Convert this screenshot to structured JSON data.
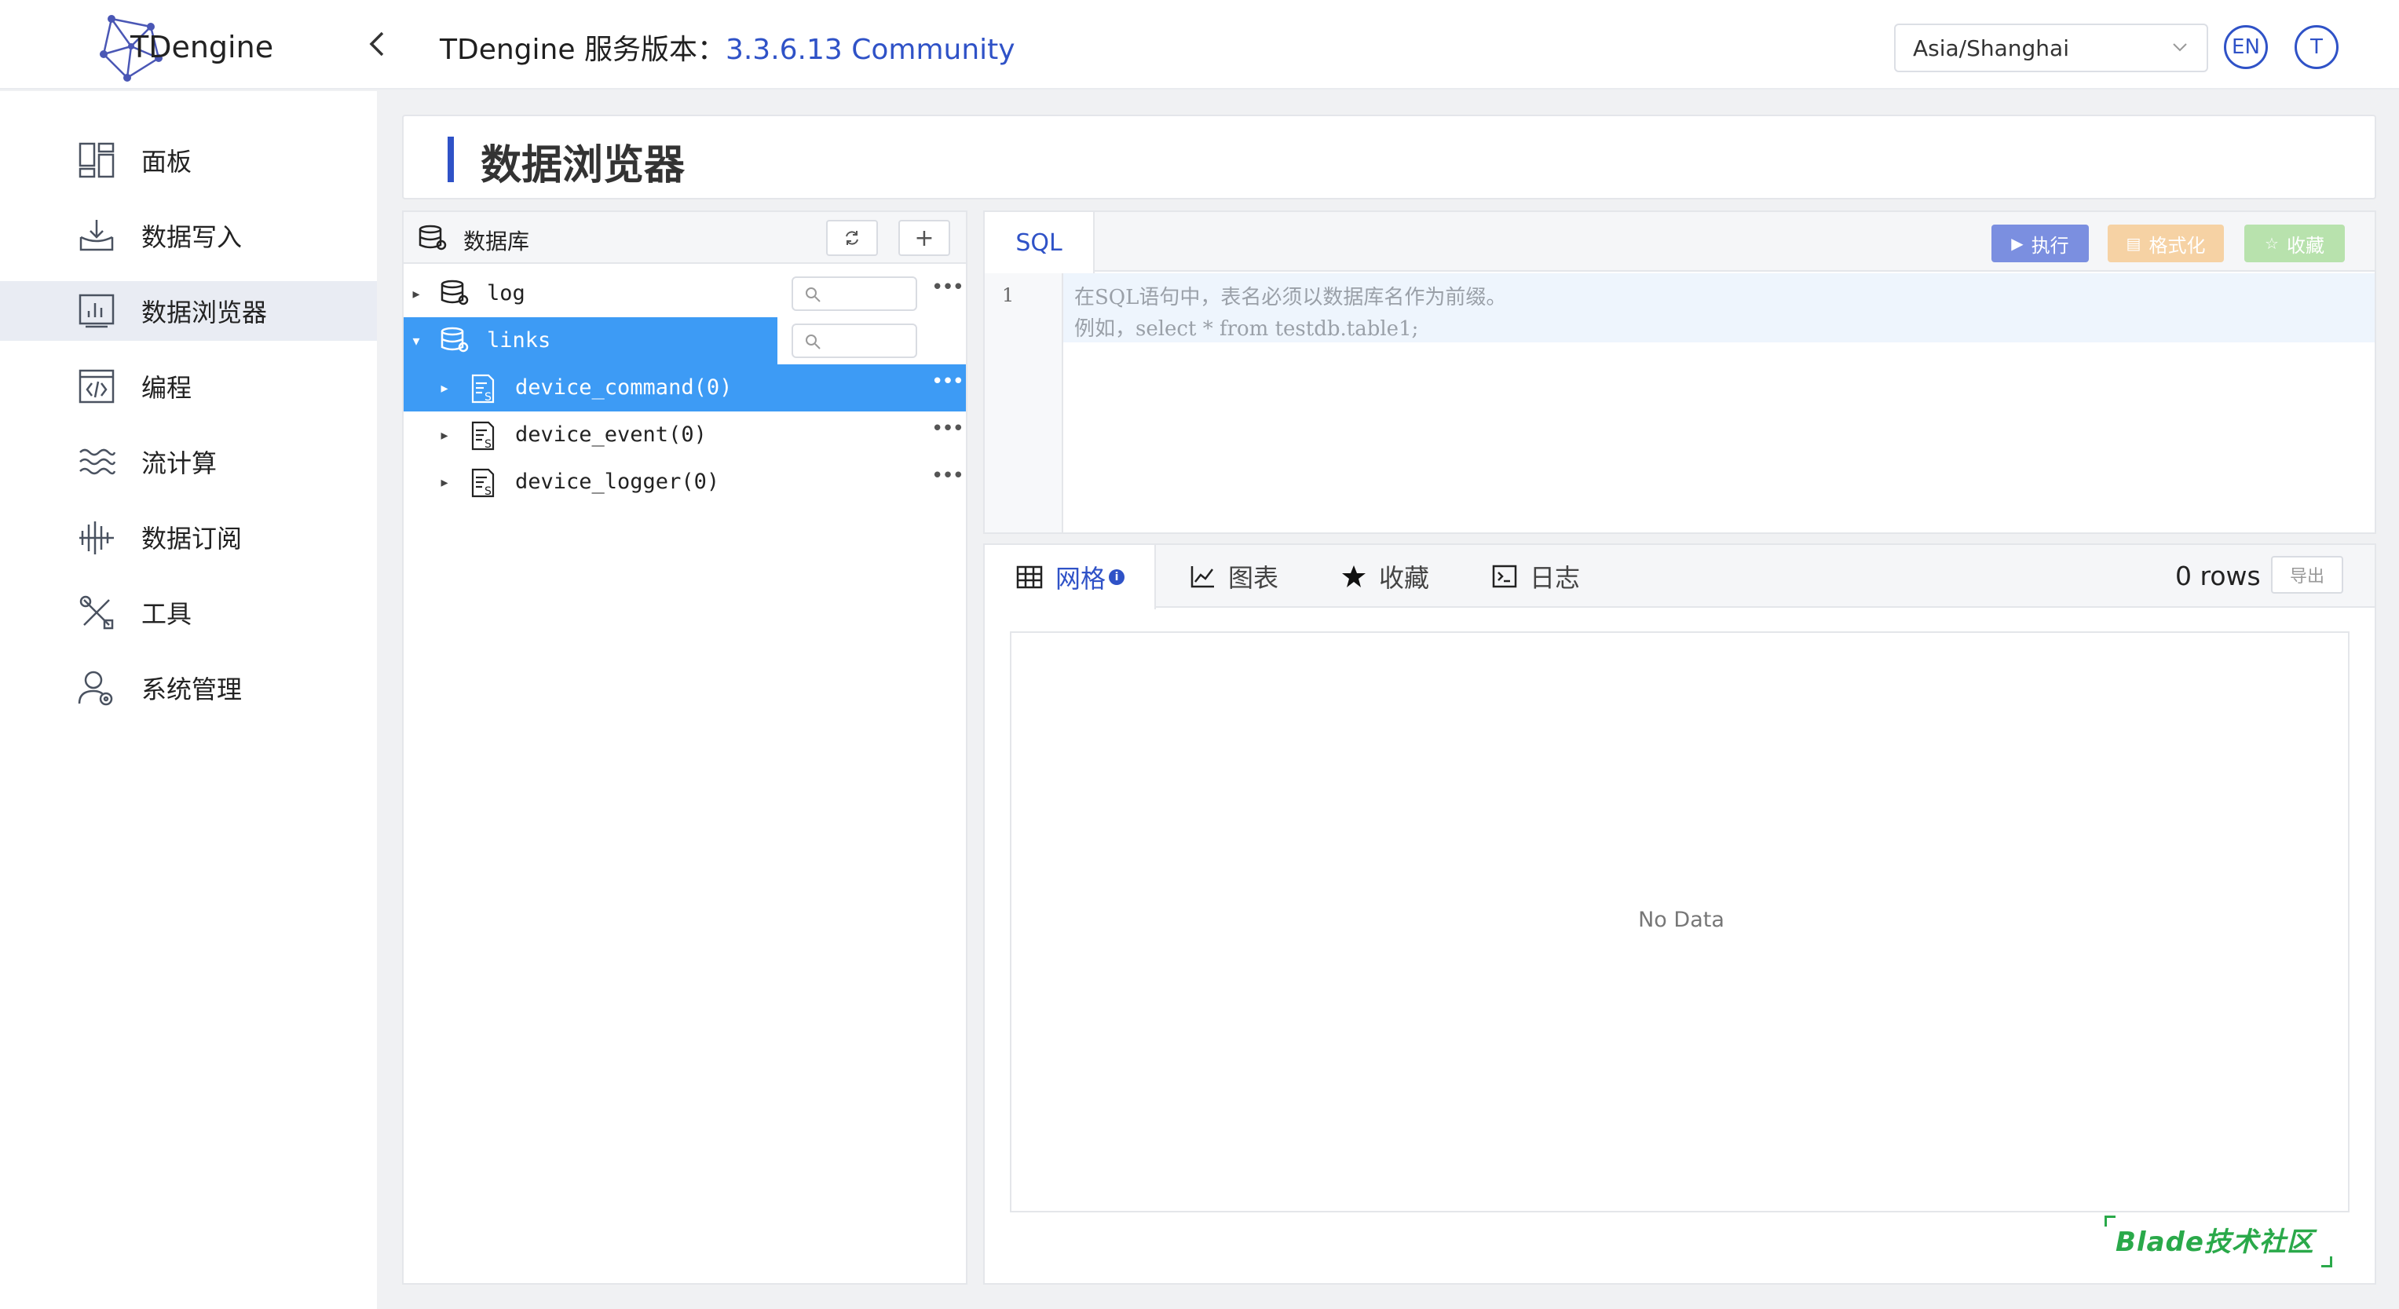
{
  "app": {
    "logo_text": "TDengine",
    "version_label": "TDengine 服务版本：",
    "version_value": "3.3.6.13 Community",
    "timezone": "Asia/Shanghai",
    "lang_button": "EN",
    "user_avatar": "T"
  },
  "sidebar": {
    "items": [
      {
        "label": "面板",
        "icon": "dashboard-icon"
      },
      {
        "label": "数据写入",
        "icon": "data-in-icon"
      },
      {
        "label": "数据浏览器",
        "icon": "data-browser-icon",
        "active": true
      },
      {
        "label": "编程",
        "icon": "code-icon"
      },
      {
        "label": "流计算",
        "icon": "stream-icon"
      },
      {
        "label": "数据订阅",
        "icon": "subscribe-icon"
      },
      {
        "label": "工具",
        "icon": "tools-icon"
      },
      {
        "label": "系统管理",
        "icon": "user-admin-icon"
      }
    ]
  },
  "page": {
    "title": "数据浏览器"
  },
  "db_panel": {
    "title": "数据库",
    "refresh_icon": "refresh-icon",
    "add_label": "+",
    "tree": [
      {
        "label": "log",
        "type": "database",
        "expanded": false
      },
      {
        "label": "links",
        "type": "database",
        "expanded": true,
        "selected": true
      },
      {
        "label": "device_command(0)",
        "type": "supertable",
        "selected": true
      },
      {
        "label": "device_event(0)",
        "type": "supertable"
      },
      {
        "label": "device_logger(0)",
        "type": "supertable"
      }
    ],
    "more_label": "•••"
  },
  "sql": {
    "tab_label": "SQL",
    "run_label": "执行",
    "format_label": "格式化",
    "favorite_label": "收藏",
    "line_number": "1",
    "placeholder_line1": "在SQL语句中，表名必须以数据库名作为前缀。",
    "placeholder_line2": "例如，select * from testdb.table1;"
  },
  "results": {
    "tabs": [
      {
        "label": "网格",
        "icon": "table-icon",
        "active": true
      },
      {
        "label": "图表",
        "icon": "line-chart-icon"
      },
      {
        "label": "收藏",
        "icon": "star-icon"
      },
      {
        "label": "日志",
        "icon": "terminal-icon"
      }
    ],
    "rows": "0 rows",
    "export_label": "导出",
    "empty_text": "No Data"
  },
  "watermark": {
    "text": "Blade技术社区"
  },
  "colors": {
    "accent": "#2f52c7",
    "selected_row": "#3d9bf5",
    "run_button": "#7b8fe0",
    "format_button": "#f6d2a4",
    "favorite_button": "#b8e2ad"
  }
}
